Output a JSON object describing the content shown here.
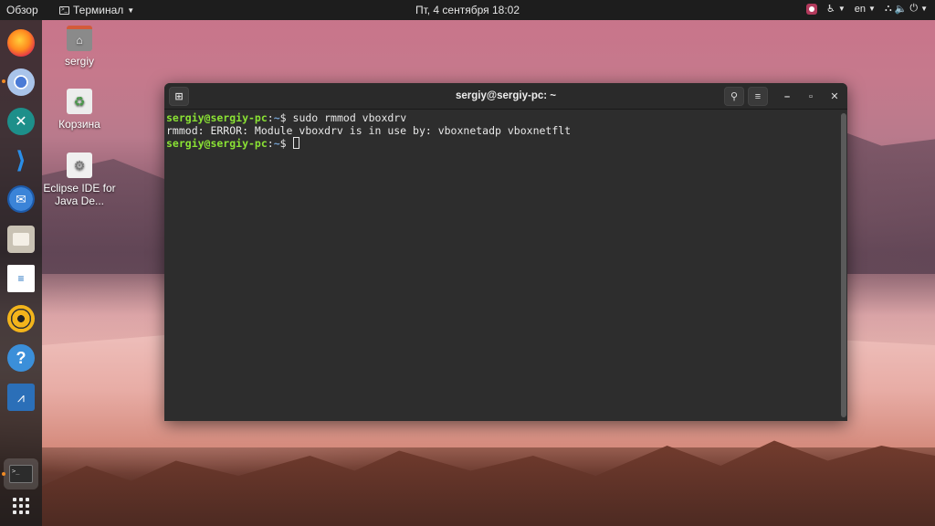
{
  "topbar": {
    "overview": "Обзор",
    "app_menu": "Терминал",
    "clock": "Пт, 4 сентября  18:02",
    "language": "en"
  },
  "dock": {
    "items": [
      {
        "name": "Firefox"
      },
      {
        "name": "Chromium"
      },
      {
        "name": "Xtend"
      },
      {
        "name": "Visual Studio Code"
      },
      {
        "name": "Thunderbird"
      },
      {
        "name": "Files"
      },
      {
        "name": "LibreOffice Writer"
      },
      {
        "name": "Rhythmbox"
      },
      {
        "name": "Help"
      },
      {
        "name": "System Monitor"
      },
      {
        "name": "Terminal"
      }
    ],
    "terminal_glyph": ">_"
  },
  "desktop": {
    "icons": [
      {
        "label": "sergiy"
      },
      {
        "label": "Корзина"
      },
      {
        "label": "Eclipse IDE for Java De..."
      }
    ]
  },
  "terminal": {
    "title": "sergiy@sergiy-pc: ~",
    "lines": [
      {
        "user": "sergiy@sergiy-pc",
        "sep": ":",
        "path": "~",
        "sym": "$ ",
        "cmd": "sudo rmmod vboxdrv"
      },
      {
        "output": "rmmod: ERROR: Module vboxdrv is in use by: vboxnetadp vboxnetflt"
      },
      {
        "user": "sergiy@sergiy-pc",
        "sep": ":",
        "path": "~",
        "sym": "$ ",
        "cmd": ""
      }
    ]
  }
}
